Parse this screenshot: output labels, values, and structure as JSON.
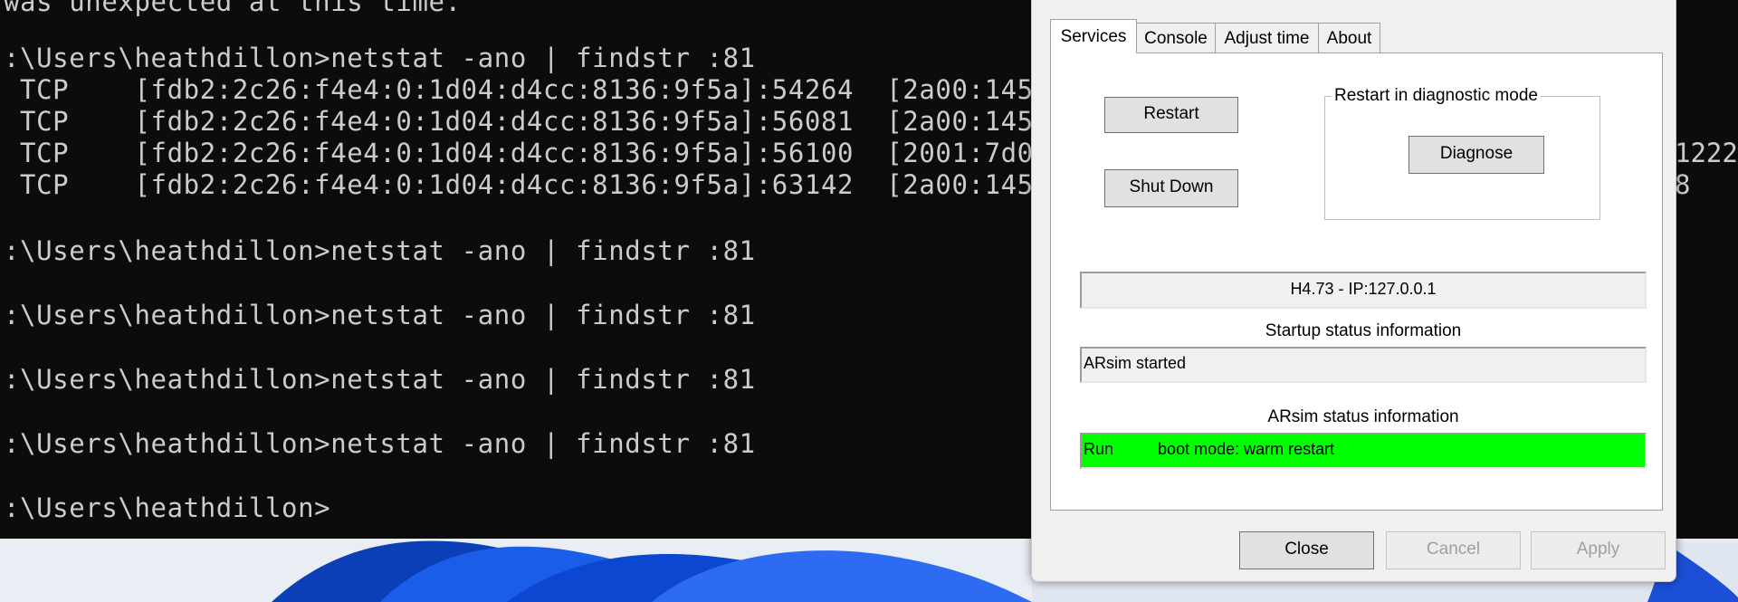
{
  "terminal": {
    "top_fragment": "was unexpected at this time.",
    "lines": [
      ":\\Users\\heathdillon>netstat -ano | findstr :81",
      " TCP    [fdb2:2c26:f4e4:0:1d04:d4cc:8136:9f5a]:54264  [2a00:1450",
      " TCP    [fdb2:2c26:f4e4:0:1d04:d4cc:8136:9f5a]:56081  [2a00:1450",
      " TCP    [fdb2:2c26:f4e4:0:1d04:d4cc:8136:9f5a]:56100  [2001:7d0:",
      " TCP    [fdb2:2c26:f4e4:0:1d04:d4cc:8136:9f5a]:63142  [2a00:1450",
      ":\\Users\\heathdillon>netstat -ano | findstr :81",
      ":\\Users\\heathdillon>netstat -ano | findstr :81",
      ":\\Users\\heathdillon>netstat -ano | findstr :81",
      ":\\Users\\heathdillon>netstat -ano | findstr :81",
      ":\\Users\\heathdillon>"
    ],
    "overflow_right": [
      "1222",
      "8"
    ]
  },
  "dialog": {
    "tabs": [
      "Services",
      "Console",
      "Adjust time",
      "About"
    ],
    "active_tab": "Services",
    "restart_button": "Restart",
    "shutdown_button": "Shut Down",
    "diagnostic_group_label": "Restart in diagnostic mode",
    "diagnose_button": "Diagnose",
    "version_field": "H4.73 - IP:127.0.0.1",
    "startup_label": "Startup status information",
    "startup_value": "ARsim started",
    "arsim_label": "ARsim status information",
    "arsim_state": "Run",
    "arsim_boot": "boot mode: warm restart",
    "arsim_color": "#00ff00",
    "close_button": "Close",
    "cancel_button": "Cancel",
    "apply_button": "Apply"
  }
}
